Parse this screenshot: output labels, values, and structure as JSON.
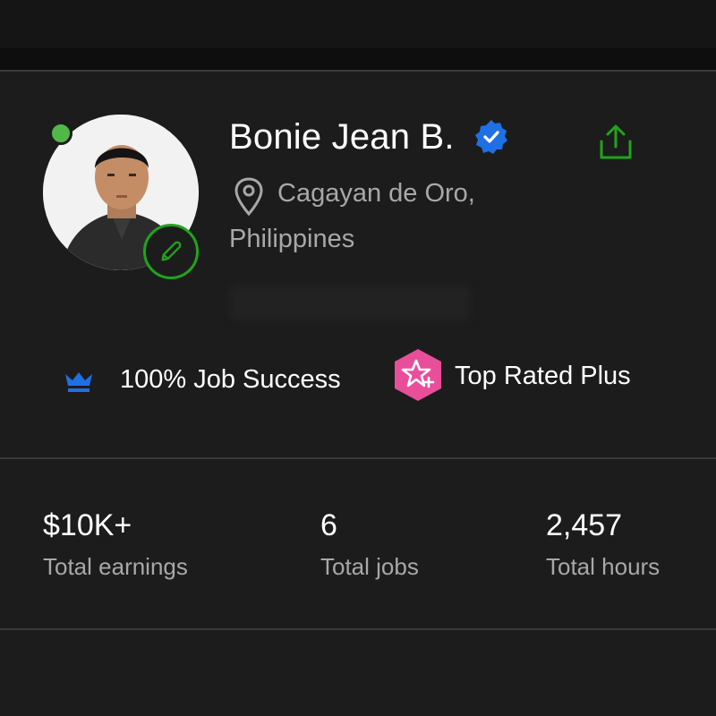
{
  "profile": {
    "name": "Bonie Jean B.",
    "location_city": "Cagayan de Oro,",
    "location_country": "Philippines",
    "online": true,
    "verified": true
  },
  "badges": {
    "job_success": "100% Job Success",
    "top_rated": "Top Rated Plus"
  },
  "stats": [
    {
      "value": "$10K+",
      "label": "Total earnings"
    },
    {
      "value": "6",
      "label": "Total jobs"
    },
    {
      "value": "2,457",
      "label": "Total hours"
    }
  ],
  "icons": {
    "verified": "verified-badge-icon",
    "share": "share-icon",
    "edit": "pencil-icon",
    "location": "location-pin-icon",
    "crown": "crown-icon",
    "top_rated": "top-rated-plus-icon"
  },
  "colors": {
    "background": "#1c1c1c",
    "accent_green": "#21a31d",
    "online_green": "#51b848",
    "verified_blue": "#1f6fe5",
    "crown_blue": "#1f6fe5",
    "top_rated_pink": "#e94e9b",
    "muted_text": "#a8a8a8"
  }
}
